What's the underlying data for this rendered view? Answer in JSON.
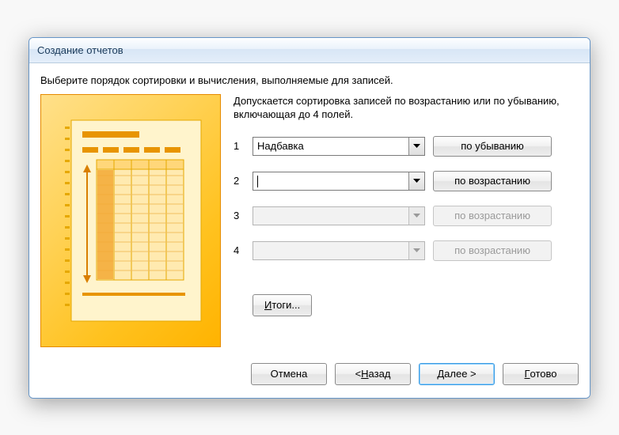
{
  "window": {
    "title": "Создание отчетов"
  },
  "instruction": "Выберите порядок сортировки и вычисления, выполняемые для записей.",
  "hint": "Допускается сортировка записей по возрастанию или по убыванию, включающая до 4 полей.",
  "sortRows": [
    {
      "num": "1",
      "field": "Надбавка",
      "order": "по убыванию",
      "disabled": false,
      "caret": false
    },
    {
      "num": "2",
      "field": "",
      "order": "по возрастанию",
      "disabled": false,
      "caret": true
    },
    {
      "num": "3",
      "field": "",
      "order": "по возрастанию",
      "disabled": true,
      "caret": false
    },
    {
      "num": "4",
      "field": "",
      "order": "по возрастанию",
      "disabled": true,
      "caret": false
    }
  ],
  "buttons": {
    "summaryPrefix": "И",
    "summaryRest": "тоги...",
    "cancel": "Отмена",
    "backPrefix": "< ",
    "backHot": "Н",
    "backRest": "азад",
    "nextHot": "Д",
    "nextRest": "алее >",
    "finishHot": "Г",
    "finishRest": "отово"
  }
}
